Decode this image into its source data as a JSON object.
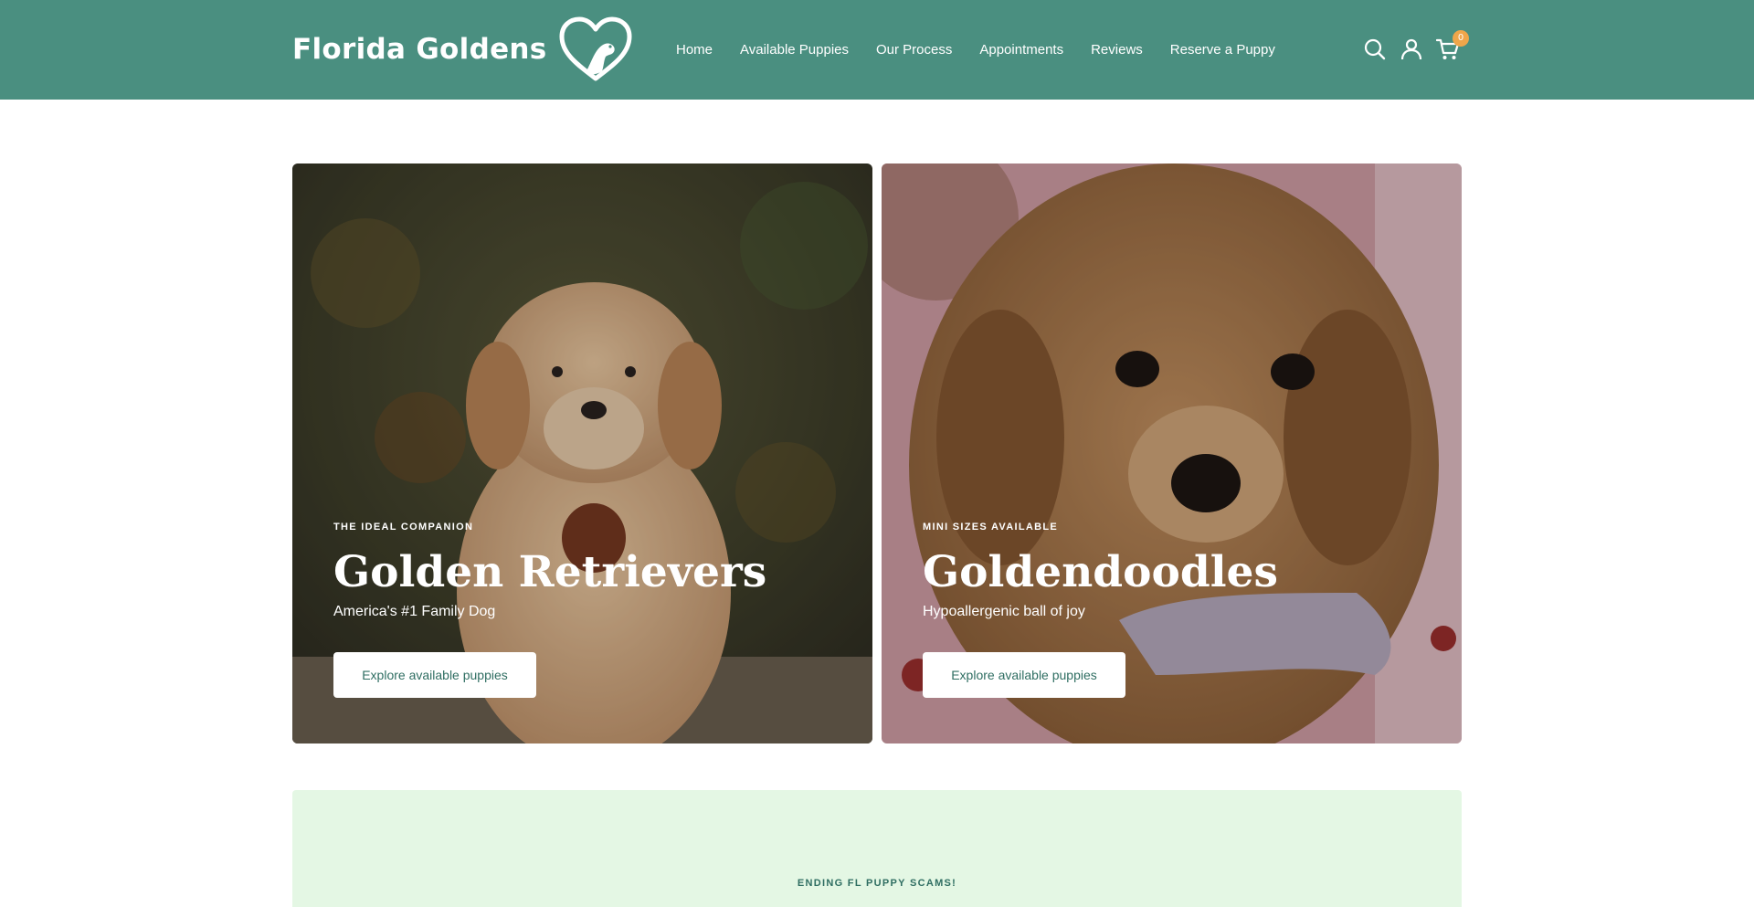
{
  "header": {
    "logo_text": "Florida Goldens",
    "nav": [
      "Home",
      "Available Puppies",
      "Our Process",
      "Appointments",
      "Reviews",
      "Reserve a Puppy"
    ],
    "cart_count": "0",
    "icons": [
      "search-icon",
      "account-icon",
      "cart-icon"
    ]
  },
  "cards": [
    {
      "eyebrow": "THE IDEAL COMPANION",
      "title": "Golden Retrievers",
      "subtitle": "America's #1 Family Dog",
      "button": "Explore available puppies"
    },
    {
      "eyebrow": "MINI SIZES AVAILABLE",
      "title": "Goldendoodles",
      "subtitle": "Hypoallergenic ball of joy",
      "button": "Explore available puppies"
    }
  ],
  "banner": {
    "eyebrow": "ENDING FL PUPPY SCAMS!"
  },
  "colors": {
    "header_bg": "#4a8f80",
    "button_text": "#2f6e62",
    "badge": "#f0a64a",
    "banner_bg": "#e4f7e4"
  }
}
